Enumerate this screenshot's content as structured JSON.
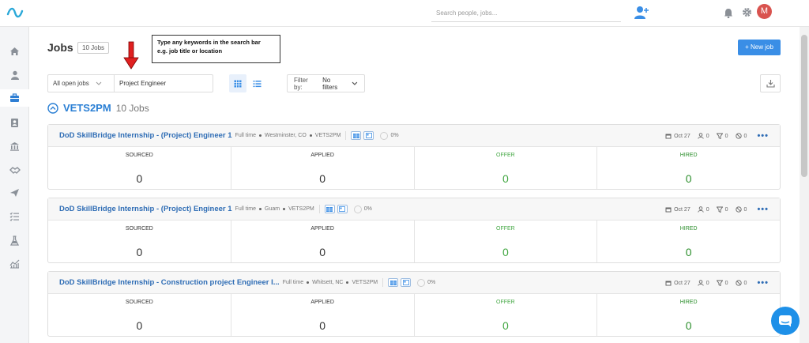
{
  "search": {
    "placeholder": "Search people, jobs..."
  },
  "user": {
    "initial": "M",
    "color": "#d9534f"
  },
  "page": {
    "title": "Jobs",
    "count": "10 Jobs"
  },
  "tooltip": {
    "line1": "Type any keywords in the search bar",
    "line2": "e.g. job title or location"
  },
  "actions": {
    "new_job": "+ New job"
  },
  "filters": {
    "status": "All open jobs",
    "keyword": "Project Engineer",
    "filter_label": "Filter by:",
    "filter_value": "No filters"
  },
  "group": {
    "name": "VETS2PM",
    "count": "10 Jobs"
  },
  "stage_labels": {
    "sourced": "SOURCED",
    "applied": "APPLIED",
    "offer": "OFFER",
    "hired": "HIRED"
  },
  "jobs": [
    {
      "title": "DoD SkillBridge Internship - (Project) Engineer 1",
      "type": "Full time",
      "location": "Westminster, CO",
      "org": "VETS2PM",
      "pct": "0%",
      "date": "Oct 27",
      "c1": "0",
      "c2": "0",
      "c3": "0",
      "sourced": "0",
      "applied": "0",
      "offer": "0",
      "hired": "0"
    },
    {
      "title": "DoD SkillBridge Internship - (Project) Engineer 1",
      "type": "Full time",
      "location": "Guam",
      "org": "VETS2PM",
      "pct": "0%",
      "date": "Oct 27",
      "c1": "0",
      "c2": "0",
      "c3": "0",
      "sourced": "0",
      "applied": "0",
      "offer": "0",
      "hired": "0"
    },
    {
      "title": "DoD SkillBridge Internship - Construction project Engineer I...",
      "type": "Full time",
      "location": "Whitsett, NC",
      "org": "VETS2PM",
      "pct": "0%",
      "date": "Oct 27",
      "c1": "0",
      "c2": "0",
      "c3": "0",
      "sourced": "0",
      "applied": "0",
      "offer": "0",
      "hired": "0"
    }
  ],
  "colors": {
    "accent": "#3a8ee6",
    "link": "#2f6db5",
    "offer": "#45a845",
    "hired": "#2d8f2d",
    "arrow": "#e02020"
  }
}
